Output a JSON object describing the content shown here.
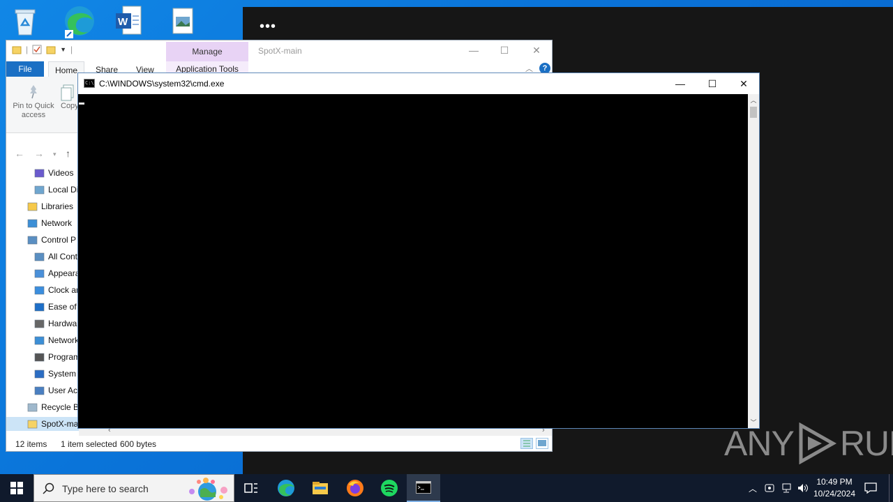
{
  "desktop": {
    "icons": [
      "recycle-bin",
      "microsoft-edge",
      "word-document",
      "image-file"
    ],
    "dark_area_menu": "•••"
  },
  "explorer": {
    "qat_separator": "|",
    "manage_tab": "Manage",
    "app_tools": "Application Tools",
    "title": "SpotX-main",
    "tabs": {
      "file": "File",
      "home": "Home",
      "share": "Share",
      "view": "View"
    },
    "ribbon": {
      "pin": "Pin to Quick access",
      "copy": "Copy"
    },
    "tree": [
      {
        "label": "Videos"
      },
      {
        "label": "Local Di"
      },
      {
        "label": "Libraries"
      },
      {
        "label": "Network"
      },
      {
        "label": "Control P"
      },
      {
        "label": "All Cont"
      },
      {
        "label": "Appeara"
      },
      {
        "label": "Clock ar"
      },
      {
        "label": "Ease of A"
      },
      {
        "label": "Hardwa"
      },
      {
        "label": "Network"
      },
      {
        "label": "Program"
      },
      {
        "label": "System"
      },
      {
        "label": "User Acc"
      },
      {
        "label": "Recycle B"
      },
      {
        "label": "SpotX-ma"
      }
    ],
    "status": {
      "items": "12 items",
      "selected": "1 item selected",
      "size": "600 bytes"
    }
  },
  "cmd": {
    "title": "C:\\WINDOWS\\system32\\cmd.exe",
    "icon_text": "C:\\",
    "minimize": "—",
    "maximize": "☐",
    "close": "✕"
  },
  "watermark": {
    "left": "ANY",
    "right": "RUN"
  },
  "taskbar": {
    "search_placeholder": "Type here to search",
    "apps": [
      "task-view",
      "microsoft-edge",
      "file-explorer",
      "firefox",
      "spotify",
      "cmd"
    ],
    "time": "10:49 PM",
    "date": "10/24/2024"
  },
  "colors": {
    "accent": "#1a6fc4",
    "manage": "#e8d3f5",
    "taskbar": "#101a2c",
    "desktop": "#0a74d9"
  }
}
